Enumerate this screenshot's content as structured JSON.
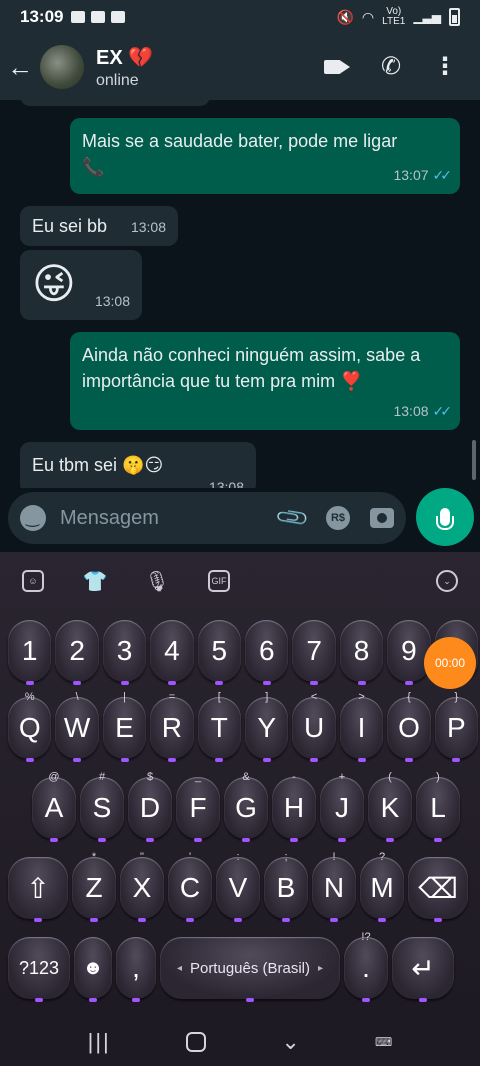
{
  "status_bar": {
    "time": "13:09",
    "network_top": "Vo)",
    "network_bottom": "LTE1"
  },
  "header": {
    "back_icon": "←",
    "contact_name": "EX 💔",
    "contact_status": "online",
    "video_icon": "video-call-icon",
    "phone_icon": "✆",
    "more_icon": "⋮"
  },
  "messages": [
    {
      "dir": "out",
      "text": "Mais se a saudade bater, pode me ligar",
      "extra": "📞",
      "time": "13:07",
      "ticks": "✓✓"
    },
    {
      "dir": "in",
      "text": "Eu sei bb",
      "time": "13:08"
    },
    {
      "dir": "in",
      "text": "😜",
      "time": "13:08"
    },
    {
      "dir": "out",
      "text": "Ainda não conheci ninguém assim, sabe a importância que tu tem pra mim ❣️",
      "time": "13:08",
      "ticks": "✓✓"
    },
    {
      "dir": "in",
      "text": "Eu tbm sei 🤫😏",
      "time": "13:08"
    }
  ],
  "input": {
    "placeholder": "Mensagem",
    "emoji_icon": "emoji-icon",
    "attach_icon": "📎",
    "pay_label": "R$",
    "camera_icon": "camera-icon",
    "mic_icon": "mic-icon"
  },
  "keyboard": {
    "toolbar": [
      "☺",
      "👕",
      "🎙",
      "GIF",
      "⌄"
    ],
    "number_row": [
      "1",
      "2",
      "3",
      "4",
      "5",
      "6",
      "7",
      "8",
      "9",
      "0"
    ],
    "row1": [
      {
        "k": "Q",
        "s": "%"
      },
      {
        "k": "W",
        "s": "\\"
      },
      {
        "k": "E",
        "s": "|"
      },
      {
        "k": "R",
        "s": "="
      },
      {
        "k": "T",
        "s": "["
      },
      {
        "k": "Y",
        "s": "]"
      },
      {
        "k": "U",
        "s": "<"
      },
      {
        "k": "I",
        "s": ">"
      },
      {
        "k": "O",
        "s": "{"
      },
      {
        "k": "P",
        "s": "}"
      }
    ],
    "row2": [
      {
        "k": "A",
        "s": "@"
      },
      {
        "k": "S",
        "s": "#"
      },
      {
        "k": "D",
        "s": "$"
      },
      {
        "k": "F",
        "s": "_"
      },
      {
        "k": "G",
        "s": "&"
      },
      {
        "k": "H",
        "s": "-"
      },
      {
        "k": "J",
        "s": "+"
      },
      {
        "k": "K",
        "s": "("
      },
      {
        "k": "L",
        "s": ")"
      }
    ],
    "row3": [
      {
        "k": "Z",
        "s": "*"
      },
      {
        "k": "X",
        "s": "\""
      },
      {
        "k": "C",
        "s": "'"
      },
      {
        "k": "V",
        "s": ":"
      },
      {
        "k": "B",
        "s": ";"
      },
      {
        "k": "N",
        "s": "!"
      },
      {
        "k": "M",
        "s": "?"
      }
    ],
    "shift": "⇧",
    "backspace": "⌫",
    "sym_key": "?123",
    "emoji_key": "☻",
    "comma": ",",
    "language": "Português (Brasil)",
    "period": ".",
    "period_sub": "!?",
    "enter": "↵",
    "timer": "00:00"
  },
  "nav": {
    "recent": "|||",
    "back": "⌄",
    "keyboard": "⌨"
  }
}
